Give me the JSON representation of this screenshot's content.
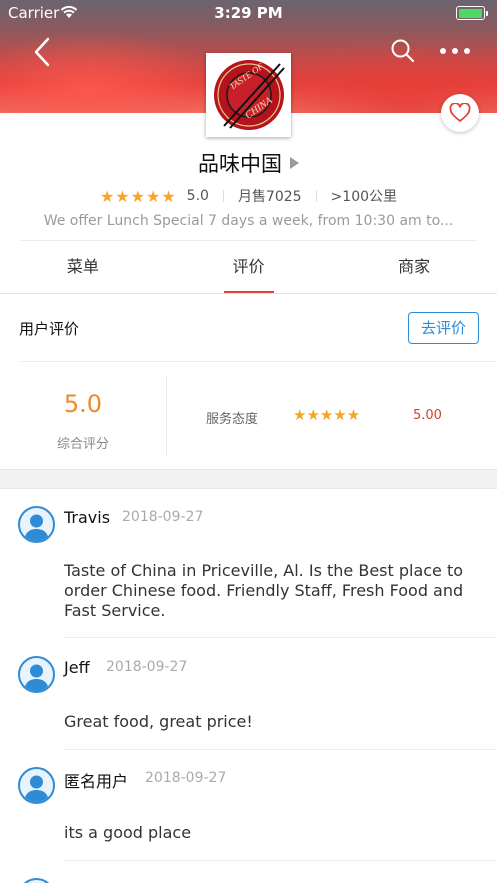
{
  "status_bar": {
    "carrier": "Carrier",
    "time": "3:29 PM",
    "battery_level": 1.0,
    "battery_color": "#4cd964"
  },
  "nav": {
    "back_icon": "chevron-left-icon",
    "search_icon": "search-icon",
    "more_icon": "more-dots-icon"
  },
  "shop": {
    "logo_text_top": "TASTE OF",
    "logo_text_bottom": "CHINA",
    "name": "品味中国",
    "stars": "★★★★★",
    "rating": "5.0",
    "monthly_sales": "月售7025",
    "distance": ">100公里",
    "description": "We offer Lunch Special 7 days a week, from 10:30 am to..."
  },
  "tabs": [
    {
      "label": "菜单",
      "active": false
    },
    {
      "label": "评价",
      "active": true
    },
    {
      "label": "商家",
      "active": false
    }
  ],
  "reviews_section": {
    "title": "用户评价",
    "write_button": "去评价",
    "overall_score": "5.0",
    "overall_label": "综合评分",
    "service_label": "服务态度",
    "service_stars": "★★★★★",
    "service_score": "5.00"
  },
  "reviews": [
    {
      "name": "Travis",
      "date": "2018-09-27",
      "text": "Taste of China in Priceville, Al. Is the Best place to order Chinese food. Friendly Staff, Fresh Food and Fast Service."
    },
    {
      "name": "Jeff",
      "date": "2018-09-27",
      "text": "Great food, great price!"
    },
    {
      "name": "匿名用户",
      "date": "2018-09-27",
      "text": "its a good place"
    }
  ],
  "colors": {
    "accent": "#e8413c",
    "link_blue": "#2e8bd6",
    "star": "#f5a623",
    "score_orange": "#f08a2c"
  }
}
